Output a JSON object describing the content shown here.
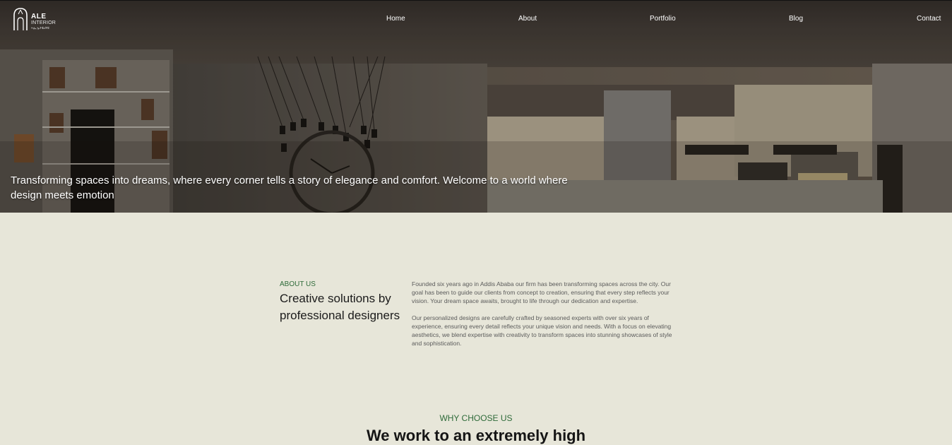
{
  "nav": {
    "logo": {
      "line1": "ALE",
      "line2": "INTERIOR",
      "line3": "ኣሌ ኢንቴሪየር"
    },
    "items": [
      "Home",
      "About",
      "Portfolio",
      "Blog",
      "Contact"
    ]
  },
  "hero": {
    "tagline": "Transforming spaces into dreams, where every corner tells a story of elegance and comfort. Welcome to a world where design meets emotion"
  },
  "about": {
    "label": "ABOUT US",
    "title": "Creative solutions by professional designers",
    "paragraph1": "Founded six years ago in Addis Ababa our firm has been transforming spaces across the city. Our goal has been to guide our clients from concept to creation, ensuring that every step reflects your vision. Your dream space awaits, brought to life through our dedication and expertise.",
    "paragraph2": "Our personalized designs are carefully crafted by seasoned experts with over six years of experience, ensuring every detail reflects your unique vision and needs. With a focus on elevating aesthetics, we blend expertise with creativity to transform spaces into stunning showcases of style and sophistication."
  },
  "why": {
    "label": "WHY CHOOSE US",
    "title": "We work to an extremely high"
  },
  "colors": {
    "background": "#e7e6d9",
    "accent_green": "#2f6b3a",
    "nav_bg": "#3a342f"
  }
}
